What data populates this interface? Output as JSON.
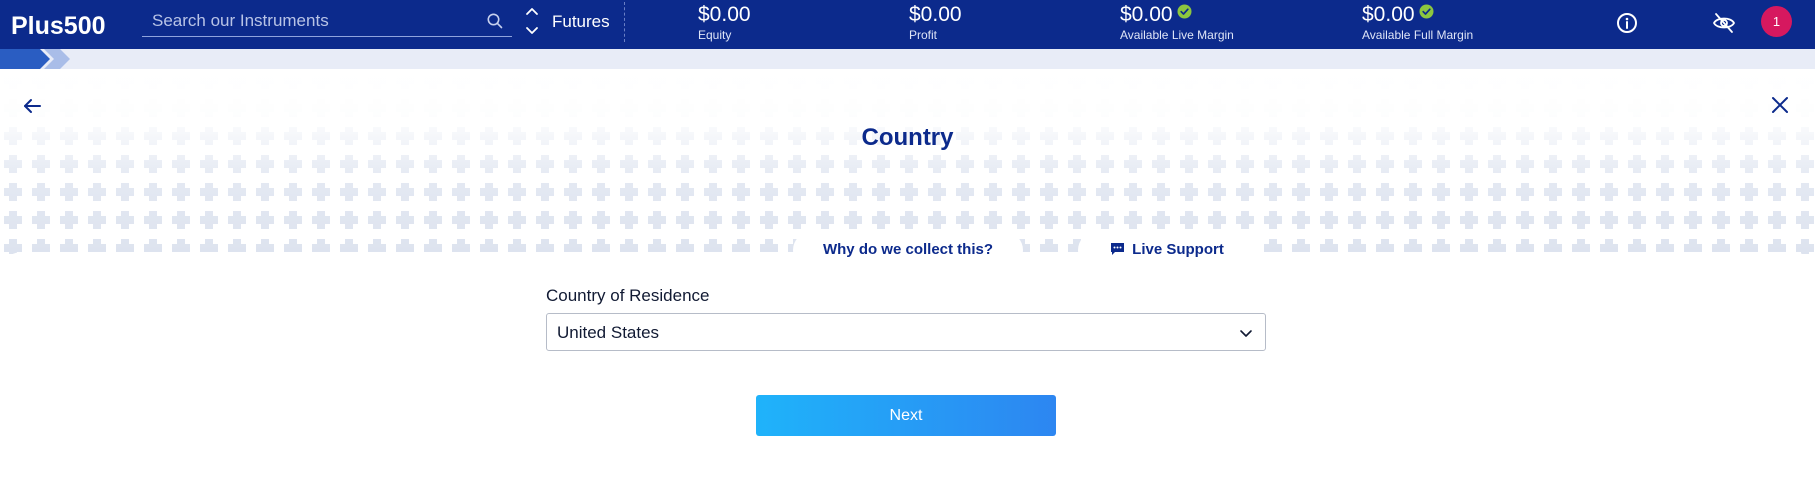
{
  "brand": {
    "logo_text": "Plus500"
  },
  "topbar": {
    "search_placeholder": "Search our Instruments",
    "mode_label": "Futures",
    "stats": [
      {
        "value": "$0.00",
        "label": "Equity",
        "verified": false
      },
      {
        "value": "$0.00",
        "label": "Profit",
        "verified": false
      },
      {
        "value": "$0.00",
        "label": "Available Live Margin",
        "verified": true
      },
      {
        "value": "$0.00",
        "label": "Available Full Margin",
        "verified": true
      }
    ],
    "notification_count": "1"
  },
  "colors": {
    "navbar": "#0c2a8c",
    "accent": "#2d86f1",
    "badge": "#d6185f",
    "check": "#8cc63f"
  },
  "page": {
    "title": "Country",
    "why_link": "Why do we collect this?",
    "support_link": "Live Support"
  },
  "form": {
    "country_label": "Country of Residence",
    "country_value": "United States",
    "next_label": "Next"
  },
  "icons": [
    "search-icon",
    "chevron-up-icon",
    "chevron-down-icon",
    "check-circle-icon",
    "info-icon",
    "eye-slash-icon",
    "arrow-left-icon",
    "close-icon",
    "chat-icon"
  ]
}
